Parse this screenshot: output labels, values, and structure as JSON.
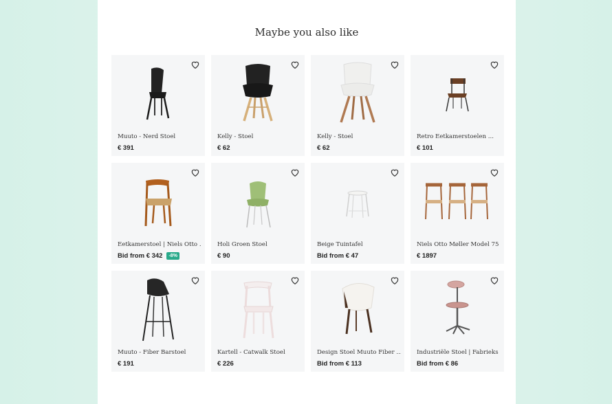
{
  "section": {
    "title": "Maybe you also like"
  },
  "products": [
    {
      "name": "Muuto - Nerd Stoel",
      "price": "€ 391",
      "badge": ""
    },
    {
      "name": "Kelly - Stoel",
      "price": "€ 62",
      "badge": ""
    },
    {
      "name": "Kelly - Stoel",
      "price": "€ 62",
      "badge": ""
    },
    {
      "name": "Retro Eetkamerstoelen ...",
      "price": "€ 101",
      "badge": ""
    },
    {
      "name": "Eetkamerstoel | Niels Otto ...",
      "price": "Bid from € 342",
      "badge": "-8%"
    },
    {
      "name": "Holi Groen Stoel",
      "price": "€ 90",
      "badge": ""
    },
    {
      "name": "Beige Tuintafel",
      "price": "Bid from € 47",
      "badge": ""
    },
    {
      "name": "Niels Otto Møller Model 75 ...",
      "price": "€ 1897",
      "badge": ""
    },
    {
      "name": "Muuto - Fiber Barstoel",
      "price": "€ 191",
      "badge": ""
    },
    {
      "name": "Kartell - Catwalk Stoel",
      "price": "€ 226",
      "badge": ""
    },
    {
      "name": "Design Stoel Muuto Fiber ...",
      "price": "Bid from € 113",
      "badge": ""
    },
    {
      "name": "Industriële Stoel | Fabrieks ...",
      "price": "Bid from € 86",
      "badge": ""
    }
  ],
  "colors": {
    "badge": "#28a98a",
    "card_bg": "#f5f6f7"
  }
}
